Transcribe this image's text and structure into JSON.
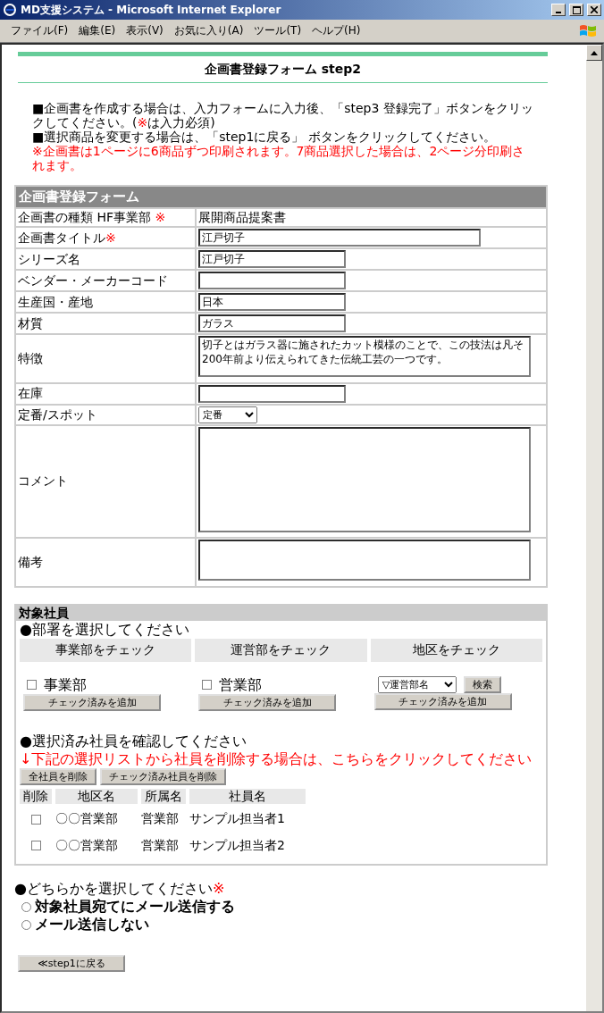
{
  "window": {
    "title": "MD支援システム - Microsoft Internet Explorer"
  },
  "menu": [
    "ファイル(F)",
    "編集(E)",
    "表示(V)",
    "お気に入り(A)",
    "ツール(T)",
    "ヘルプ(H)"
  ],
  "page_title": "企画書登録フォーム step2",
  "instructions": [
    {
      "text": "■企画書を作成する場合は、入力フォームに入力後、「step3 登録完了」ボタンをクリックしてください。(",
      "mark": "※",
      "tail": "は入力必須)",
      "kind": "normal"
    },
    {
      "text": "■選択商品を変更する場合は、「step1に戻る」 ボタンをクリックしてください。",
      "kind": "normal"
    },
    {
      "text": "※企画書は1ページに6商品ずつ印刷されます。7商品選択した場合は、2ページ分印刷されます。",
      "kind": "warning"
    }
  ],
  "form": {
    "header": "企画書登録フォーム",
    "fields": [
      {
        "label": "企画書の種類 HF事業部 ",
        "mark": "※",
        "kind": "static",
        "value": "展開商品提案書"
      },
      {
        "label": "企画書タイトル",
        "mark": "※",
        "kind": "wide_text",
        "value": "江戸切子"
      },
      {
        "label": "シリーズ名",
        "kind": "text",
        "value": "江戸切子"
      },
      {
        "label": "ベンダー・メーカーコード",
        "kind": "text"
      },
      {
        "label": "生産国・産地",
        "kind": "text",
        "value": "日本"
      },
      {
        "label": "材質",
        "kind": "text",
        "value": "ガラス"
      },
      {
        "label": "特徴",
        "kind": "textarea",
        "value": "切子とはガラス器に施されたカット模様のことで、この技法は凡そ200年前より伝えられてきた伝統工芸の一つです。"
      },
      {
        "label": "在庫",
        "kind": "text"
      },
      {
        "label": "定番/スポット",
        "kind": "select",
        "value": "定番"
      },
      {
        "label": "コメント",
        "kind": "tall_textarea"
      },
      {
        "label": "備考",
        "kind": "textarea"
      }
    ]
  },
  "employees": {
    "header": "対象社員",
    "dept_prompt": "●部署を選択してください",
    "groups": [
      {
        "heading": "事業部をチェック",
        "kind": "checkbox",
        "option": "事業部",
        "checked": false,
        "button": "チェック済みを追加"
      },
      {
        "heading": "運営部をチェック",
        "kind": "checkbox",
        "option": "営業部",
        "checked": false,
        "button": "チェック済みを追加"
      },
      {
        "heading": "地区をチェック",
        "kind": "select",
        "option": "▽運営部名",
        "search_button": "検索",
        "button": "チェック済みを追加"
      }
    ],
    "confirm_prompt": "●選択済み社員を確認してください",
    "delete_hint": "↓下記の選択リストから社員を削除する場合は、こちらをクリックしてください",
    "delete_buttons": [
      "全社員を削除",
      "チェック済み社員を削除"
    ],
    "delete_column": "削除",
    "columns": [
      "地区名",
      "所属名",
      "社員名"
    ],
    "rows": [
      {
        "checked": false,
        "cells": [
          "〇〇営業部",
          "営業部",
          "サンプル担当者1"
        ]
      },
      {
        "checked": false,
        "cells": [
          "〇〇営業部",
          "営業部",
          "サンプル担当者2"
        ]
      }
    ]
  },
  "mail": {
    "prompt": "●どちらかを選択してください",
    "mark": "※",
    "options": [
      {
        "label": "対象社員宛てにメール送信する",
        "selected": false
      },
      {
        "label": "メール送信しない",
        "selected": false
      }
    ]
  },
  "back_button": "≪step1に戻る"
}
